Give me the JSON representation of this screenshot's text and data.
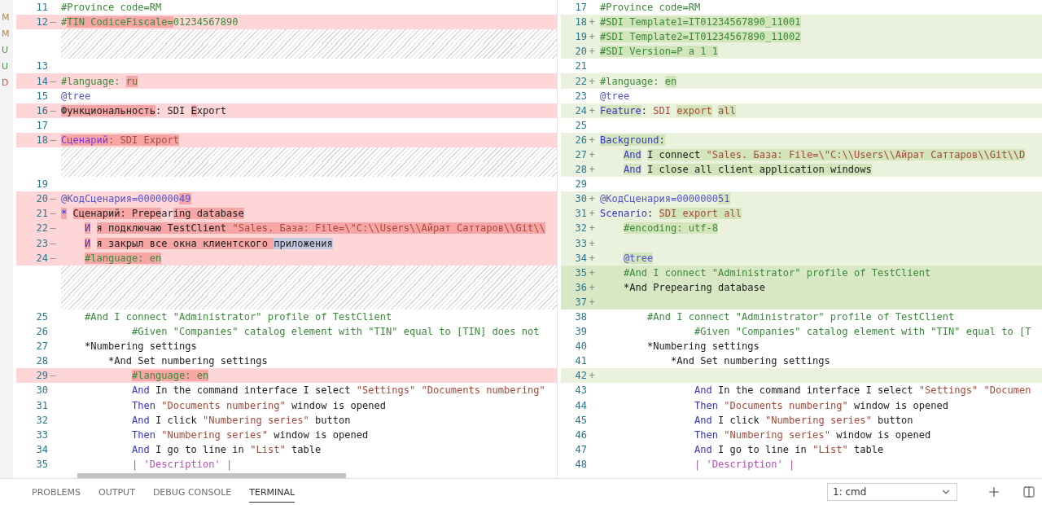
{
  "git_markers": [
    {
      "letter": "M",
      "color": "#b58a3a"
    },
    {
      "letter": "M",
      "color": "#b58a3a"
    },
    {
      "letter": "U",
      "color": "#4a9a4a"
    },
    {
      "letter": "U",
      "color": "#4a9a4a"
    },
    {
      "letter": "D",
      "color": "#c0504a"
    }
  ],
  "left": {
    "lines": [
      {
        "kind": "context",
        "num": "11",
        "segments": [
          {
            "kind": "comment",
            "text": "#Province code=RM"
          }
        ]
      },
      {
        "kind": "removed",
        "num": "12",
        "sign": "—",
        "segments": [
          {
            "kind": "comment",
            "text": "#"
          },
          {
            "kind": "comment",
            "text": "TIN CodiceFiscale=",
            "changed": true
          },
          {
            "kind": "comment",
            "text": "01234567890"
          }
        ]
      },
      {
        "kind": "filler"
      },
      {
        "kind": "filler"
      },
      {
        "kind": "context",
        "num": "13"
      },
      {
        "kind": "removed",
        "num": "14",
        "sign": "—",
        "segments": [
          {
            "kind": "comment",
            "text": "#language: "
          },
          {
            "kind": "comment",
            "text": "ru",
            "changed": true
          }
        ]
      },
      {
        "kind": "context",
        "num": "15",
        "segments": [
          {
            "kind": "tag",
            "text": "@tree"
          }
        ]
      },
      {
        "kind": "removed",
        "num": "16",
        "sign": "—",
        "segments": [
          {
            "kind": "plain",
            "text": "Функциональность",
            "changed": true
          },
          {
            "kind": "plain",
            "text": ": SDI "
          },
          {
            "kind": "plain",
            "text": "E",
            "changed": true
          },
          {
            "kind": "plain",
            "text": "xport"
          }
        ]
      },
      {
        "kind": "context",
        "num": "17"
      },
      {
        "kind": "removed",
        "num": "18",
        "sign": "—",
        "segments": [
          {
            "kind": "keyword2",
            "text": "Сценарий",
            "changed": true
          },
          {
            "kind": "string",
            "text": ": SDI Export",
            "changed": true
          }
        ]
      },
      {
        "kind": "filler"
      },
      {
        "kind": "filler"
      },
      {
        "kind": "context",
        "num": "19"
      },
      {
        "kind": "removed",
        "num": "20",
        "sign": "—",
        "segments": [
          {
            "kind": "tag",
            "text": "@КодСценария=0000000"
          },
          {
            "kind": "tag",
            "text": "49",
            "changed": true
          }
        ]
      },
      {
        "kind": "removed",
        "num": "21",
        "sign": "—",
        "segments": [
          {
            "kind": "keyword",
            "text": "*",
            "changed": true
          },
          {
            "kind": "plain",
            "text": " Сценарий: Prepe",
            "changed": true
          },
          {
            "kind": "plain",
            "text": "ar"
          },
          {
            "kind": "plain",
            "text": "ing database",
            "changed": true
          }
        ]
      },
      {
        "kind": "removed",
        "num": "22",
        "sign": "—",
        "segments": [
          {
            "kind": "keyword",
            "text": "    И",
            "changed": true
          },
          {
            "kind": "plain",
            "text": " я подключаю TestClient ",
            "changed": true
          },
          {
            "kind": "string",
            "text": "\"Sales. База: File=\\\"C:\\\\Users\\\\Айрат Саттаров\\\\Git\\\\",
            "changed": true
          }
        ]
      },
      {
        "kind": "removed",
        "num": "23",
        "sign": "—",
        "segments": [
          {
            "kind": "keyword",
            "text": "    И",
            "changed": true
          },
          {
            "kind": "plain",
            "text": " я закрыл все окна клиентского ",
            "changed": true
          },
          {
            "kind": "plain",
            "text": "приложения",
            "selection": true
          }
        ]
      },
      {
        "kind": "removed",
        "num": "24",
        "sign": "—",
        "segments": [
          {
            "kind": "comment",
            "text": "    #language: en",
            "changed": true
          }
        ]
      },
      {
        "kind": "filler"
      },
      {
        "kind": "filler"
      },
      {
        "kind": "filler"
      },
      {
        "kind": "context",
        "num": "25",
        "segments": [
          {
            "kind": "comment",
            "text": "    #And I connect \"Administrator\" profile of TestClient"
          }
        ]
      },
      {
        "kind": "context",
        "num": "26",
        "segments": [
          {
            "kind": "comment",
            "text": "            #Given \"Companies\" catalog element with \"TIN\" equal to [TIN] does not"
          }
        ]
      },
      {
        "kind": "context",
        "num": "27",
        "segments": [
          {
            "kind": "plain",
            "text": "    *Numbering settings"
          }
        ]
      },
      {
        "kind": "context",
        "num": "28",
        "segments": [
          {
            "kind": "plain",
            "text": "        *And Set numbering settings"
          }
        ]
      },
      {
        "kind": "removed",
        "num": "29",
        "sign": "—",
        "segments": [
          {
            "kind": "comment",
            "text": "            #language: en",
            "changed": true
          }
        ]
      },
      {
        "kind": "context",
        "num": "30",
        "segments": [
          {
            "kind": "keyword",
            "text": "            And"
          },
          {
            "kind": "plain",
            "text": " In the command interface I select "
          },
          {
            "kind": "string",
            "text": "\"Settings\" \"Documents numbering\""
          }
        ]
      },
      {
        "kind": "context",
        "num": "31",
        "segments": [
          {
            "kind": "keyword",
            "text": "            Then"
          },
          {
            "kind": "string",
            "text": " \"Documents numbering\""
          },
          {
            "kind": "plain",
            "text": " window is opened"
          }
        ]
      },
      {
        "kind": "context",
        "num": "32",
        "segments": [
          {
            "kind": "keyword",
            "text": "            And"
          },
          {
            "kind": "plain",
            "text": " I click "
          },
          {
            "kind": "string",
            "text": "\"Numbering series\""
          },
          {
            "kind": "plain",
            "text": " button"
          }
        ]
      },
      {
        "kind": "context",
        "num": "33",
        "segments": [
          {
            "kind": "keyword",
            "text": "            Then"
          },
          {
            "kind": "string",
            "text": " \"Numbering series\""
          },
          {
            "kind": "plain",
            "text": " window is opened"
          }
        ]
      },
      {
        "kind": "context",
        "num": "34",
        "segments": [
          {
            "kind": "keyword",
            "text": "            And"
          },
          {
            "kind": "plain",
            "text": " I go to line in "
          },
          {
            "kind": "string",
            "text": "\"List\""
          },
          {
            "kind": "plain",
            "text": " table"
          }
        ]
      },
      {
        "kind": "context",
        "num": "35",
        "segments": [
          {
            "kind": "table",
            "text": "            | 'Description' |"
          }
        ]
      }
    ]
  },
  "right": {
    "lines": [
      {
        "kind": "context",
        "num": "17",
        "segments": [
          {
            "kind": "comment",
            "text": "#Province code=RM"
          }
        ]
      },
      {
        "kind": "added",
        "num": "18",
        "sign": "+",
        "segments": [
          {
            "kind": "comment",
            "text": "#SDI Template1=IT01234567890_11001",
            "changed": true
          }
        ]
      },
      {
        "kind": "added",
        "num": "19",
        "sign": "+",
        "segments": [
          {
            "kind": "comment",
            "text": "#SDI Template2=IT01234567890_11002",
            "changed": true
          }
        ]
      },
      {
        "kind": "added",
        "num": "20",
        "sign": "+",
        "segments": [
          {
            "kind": "comment",
            "text": "#SDI Version=P a 1 1",
            "changed": true
          }
        ]
      },
      {
        "kind": "context",
        "num": "21"
      },
      {
        "kind": "added",
        "num": "22",
        "sign": "+",
        "segments": [
          {
            "kind": "comment",
            "text": "#language: "
          },
          {
            "kind": "comment",
            "text": "en",
            "changed": true
          }
        ]
      },
      {
        "kind": "context",
        "num": "23",
        "segments": [
          {
            "kind": "tag",
            "text": "@tree"
          }
        ]
      },
      {
        "kind": "added",
        "num": "24",
        "sign": "+",
        "segments": [
          {
            "kind": "keyword",
            "text": "Feature",
            "changed": true
          },
          {
            "kind": "plain",
            "text": ": "
          },
          {
            "kind": "string",
            "text": "SDI "
          },
          {
            "kind": "string",
            "text": "export",
            "changed": true
          },
          {
            "kind": "string",
            "text": " all",
            "changed": true
          }
        ]
      },
      {
        "kind": "context",
        "num": "25"
      },
      {
        "kind": "added",
        "num": "26",
        "sign": "+",
        "segments": [
          {
            "kind": "keyword",
            "text": "Background",
            "changed": true
          },
          {
            "kind": "plain",
            "text": ":",
            "changed": true
          }
        ]
      },
      {
        "kind": "added",
        "num": "27",
        "sign": "+",
        "segments": [
          {
            "kind": "keyword",
            "text": "    And",
            "changed": true
          },
          {
            "kind": "plain",
            "text": " I connect ",
            "changed": true
          },
          {
            "kind": "string",
            "text": "\"Sales. База: File=\\\"C:\\\\Users\\\\Айрат Саттаров\\\\Git\\\\D",
            "changed": true
          }
        ]
      },
      {
        "kind": "added",
        "num": "28",
        "sign": "+",
        "segments": [
          {
            "kind": "keyword",
            "text": "    And",
            "changed": true
          },
          {
            "kind": "plain",
            "text": " I close all client application windows",
            "changed": true
          }
        ]
      },
      {
        "kind": "context",
        "num": "29"
      },
      {
        "kind": "added",
        "num": "30",
        "sign": "+",
        "segments": [
          {
            "kind": "tag",
            "text": "@КодСценария=0000000"
          },
          {
            "kind": "tag",
            "text": "51",
            "changed": true
          }
        ]
      },
      {
        "kind": "added",
        "num": "31",
        "sign": "+",
        "segments": [
          {
            "kind": "keyword",
            "text": "Scenario"
          },
          {
            "kind": "plain",
            "text": ": "
          },
          {
            "kind": "string",
            "text": "SDI export all",
            "changed": true
          }
        ]
      },
      {
        "kind": "added",
        "num": "32",
        "sign": "+",
        "segments": [
          {
            "kind": "comment",
            "text": "    #encoding: utf-8",
            "changed": true
          }
        ]
      },
      {
        "kind": "added",
        "num": "33",
        "sign": "+"
      },
      {
        "kind": "added",
        "num": "34",
        "sign": "+",
        "segments": [
          {
            "kind": "tag",
            "text": "    @tree",
            "changed": true
          }
        ]
      },
      {
        "kind": "strong",
        "num": "35",
        "sign": "+",
        "segments": [
          {
            "kind": "comment",
            "text": "    #And I connect \"Administrator\" profile of TestClient"
          }
        ]
      },
      {
        "kind": "strong",
        "num": "36",
        "sign": "+",
        "segments": [
          {
            "kind": "plain",
            "text": "    *And Prepearing database"
          }
        ]
      },
      {
        "kind": "strong",
        "num": "37",
        "sign": "+"
      },
      {
        "kind": "context",
        "num": "38",
        "segments": [
          {
            "kind": "comment",
            "text": "        #And I connect \"Administrator\" profile of TestClient"
          }
        ]
      },
      {
        "kind": "context",
        "num": "39",
        "segments": [
          {
            "kind": "comment",
            "text": "                #Given \"Companies\" catalog element with \"TIN\" equal to [T"
          }
        ]
      },
      {
        "kind": "context",
        "num": "40",
        "segments": [
          {
            "kind": "plain",
            "text": "        *Numbering settings"
          }
        ]
      },
      {
        "kind": "context",
        "num": "41",
        "segments": [
          {
            "kind": "plain",
            "text": "            *And Set numbering settings"
          }
        ]
      },
      {
        "kind": "added",
        "num": "42",
        "sign": "+"
      },
      {
        "kind": "context",
        "num": "43",
        "segments": [
          {
            "kind": "keyword",
            "text": "                And"
          },
          {
            "kind": "plain",
            "text": " In the command interface I select "
          },
          {
            "kind": "string",
            "text": "\"Settings\" \"Documen"
          }
        ]
      },
      {
        "kind": "context",
        "num": "44",
        "segments": [
          {
            "kind": "keyword",
            "text": "                Then"
          },
          {
            "kind": "string",
            "text": " \"Documents numbering\""
          },
          {
            "kind": "plain",
            "text": " window is opened"
          }
        ]
      },
      {
        "kind": "context",
        "num": "45",
        "segments": [
          {
            "kind": "keyword",
            "text": "                And"
          },
          {
            "kind": "plain",
            "text": " I click "
          },
          {
            "kind": "string",
            "text": "\"Numbering series\""
          },
          {
            "kind": "plain",
            "text": " button"
          }
        ]
      },
      {
        "kind": "context",
        "num": "46",
        "segments": [
          {
            "kind": "keyword",
            "text": "                Then"
          },
          {
            "kind": "string",
            "text": " \"Numbering series\""
          },
          {
            "kind": "plain",
            "text": " window is opened"
          }
        ]
      },
      {
        "kind": "context",
        "num": "47",
        "segments": [
          {
            "kind": "keyword",
            "text": "                And"
          },
          {
            "kind": "plain",
            "text": " I go to line in "
          },
          {
            "kind": "string",
            "text": "\"List\""
          },
          {
            "kind": "plain",
            "text": " table"
          }
        ]
      },
      {
        "kind": "context",
        "num": "48",
        "segments": [
          {
            "kind": "table",
            "text": "                | 'Description' |"
          }
        ]
      }
    ]
  },
  "panel": {
    "tabs": [
      {
        "label": "PROBLEMS",
        "selected": false
      },
      {
        "label": "OUTPUT",
        "selected": false
      },
      {
        "label": "DEBUG CONSOLE",
        "selected": false
      },
      {
        "label": "TERMINAL",
        "selected": true
      }
    ],
    "terminal_select": {
      "value": "1: cmd"
    }
  }
}
